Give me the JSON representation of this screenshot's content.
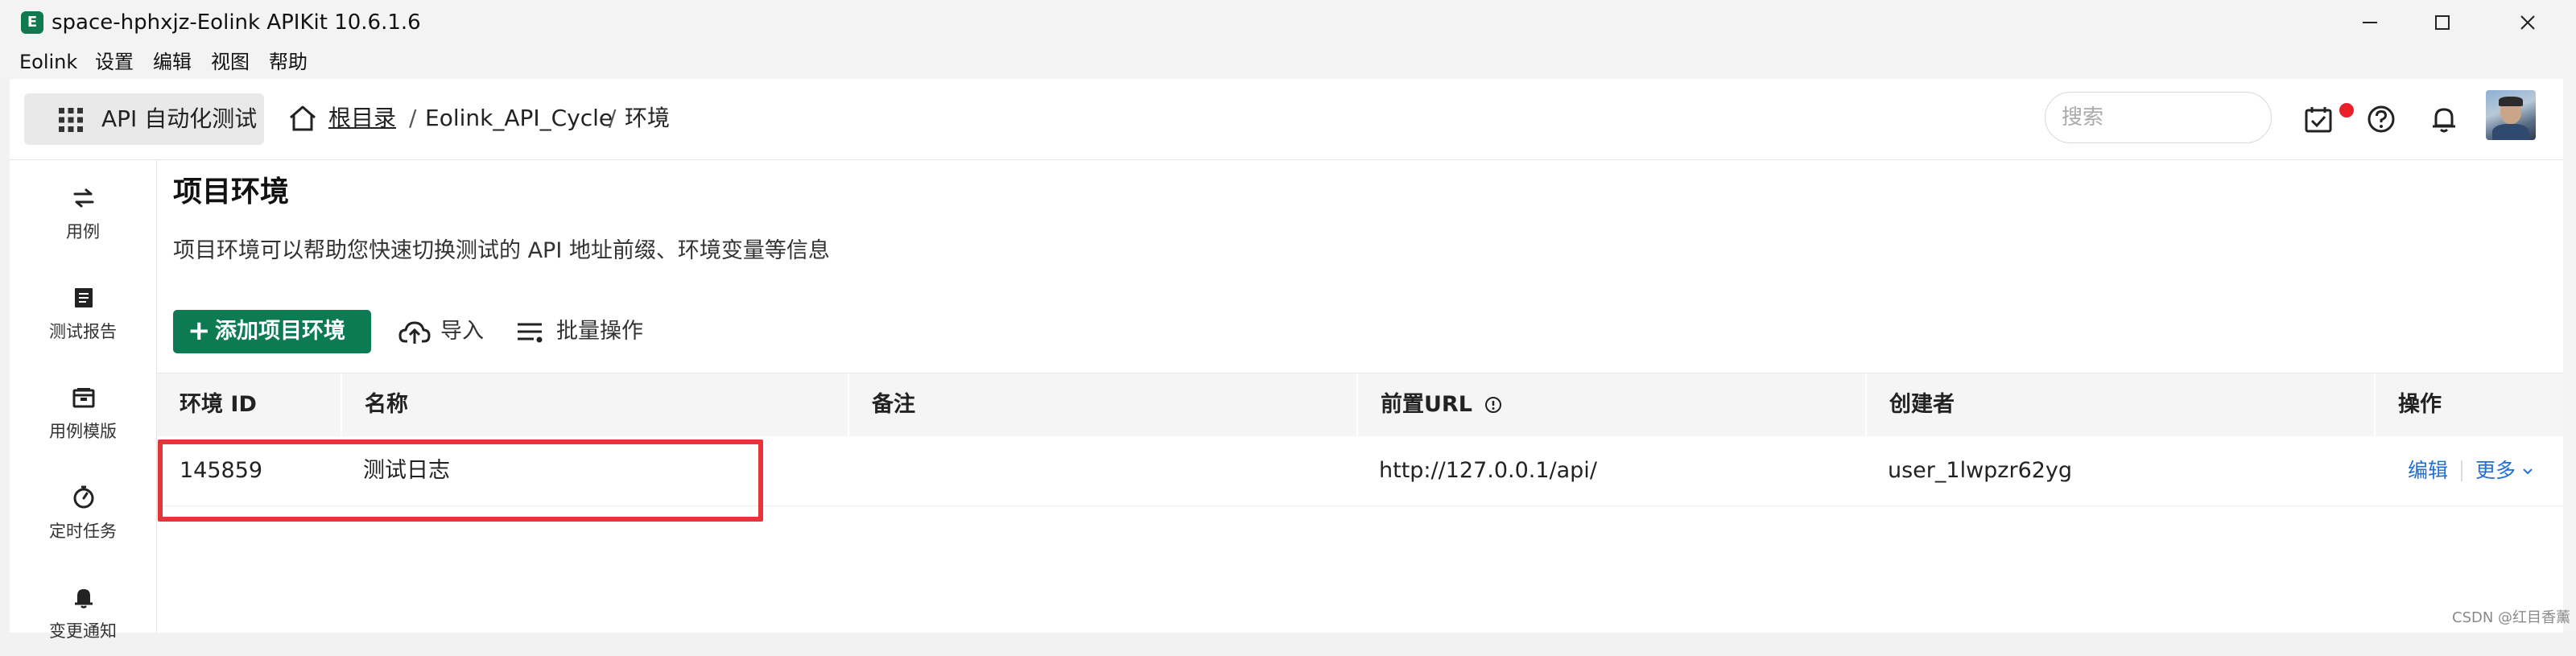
{
  "window": {
    "title": "space-hphxjz-Eolink APIKit 10.6.1.6",
    "logo_glyph": "E",
    "controls": {
      "minimize_icon": "minimize-icon",
      "maximize_icon": "maximize-icon",
      "close_icon": "close-icon"
    }
  },
  "menu": [
    "Eolink",
    "设置",
    "编辑",
    "视图",
    "帮助"
  ],
  "header": {
    "module_label": "API 自动化测试",
    "module_icon": "grid-icon",
    "breadcrumb": {
      "root": "根目录",
      "project": "Eolink_API_Cycle",
      "current": "环境",
      "separator": "/"
    },
    "search_placeholder": "搜索",
    "icons": [
      "task-check-icon",
      "help-icon",
      "bell-icon",
      "avatar"
    ],
    "notification_dot_color": "#e8202a"
  },
  "sidebar": {
    "items": [
      {
        "label": "用例",
        "icon": "swap-arrows-icon"
      },
      {
        "label": "测试报告",
        "icon": "report-icon"
      },
      {
        "label": "用例模版",
        "icon": "template-icon"
      },
      {
        "label": "定时任务",
        "icon": "timer-icon"
      },
      {
        "label": "变更通知",
        "icon": "bell-icon"
      }
    ]
  },
  "main": {
    "title": "项目环境",
    "description": "项目环境可以帮助您快速切换测试的 API 地址前缀、环境变量等信息",
    "actions": {
      "add_label": "添加项目环境",
      "add_glyph": "+",
      "import_label": "导入",
      "batch_label": "批量操作"
    },
    "table": {
      "columns": [
        "环境 ID",
        "名称",
        "备注",
        "前置URL",
        "创建者",
        "操作"
      ],
      "rows": [
        {
          "id": "145859",
          "name": "测试日志",
          "remark": "",
          "base_url": "http://127.0.0.1/api/",
          "creator": "user_1lwpzr62yg",
          "edit": "编辑",
          "more": "更多"
        }
      ]
    }
  },
  "colors": {
    "accent": "#0c7a52",
    "link": "#1f6fd6",
    "highlight": "#e5343a"
  },
  "watermark": "CSDN @红目香薰"
}
